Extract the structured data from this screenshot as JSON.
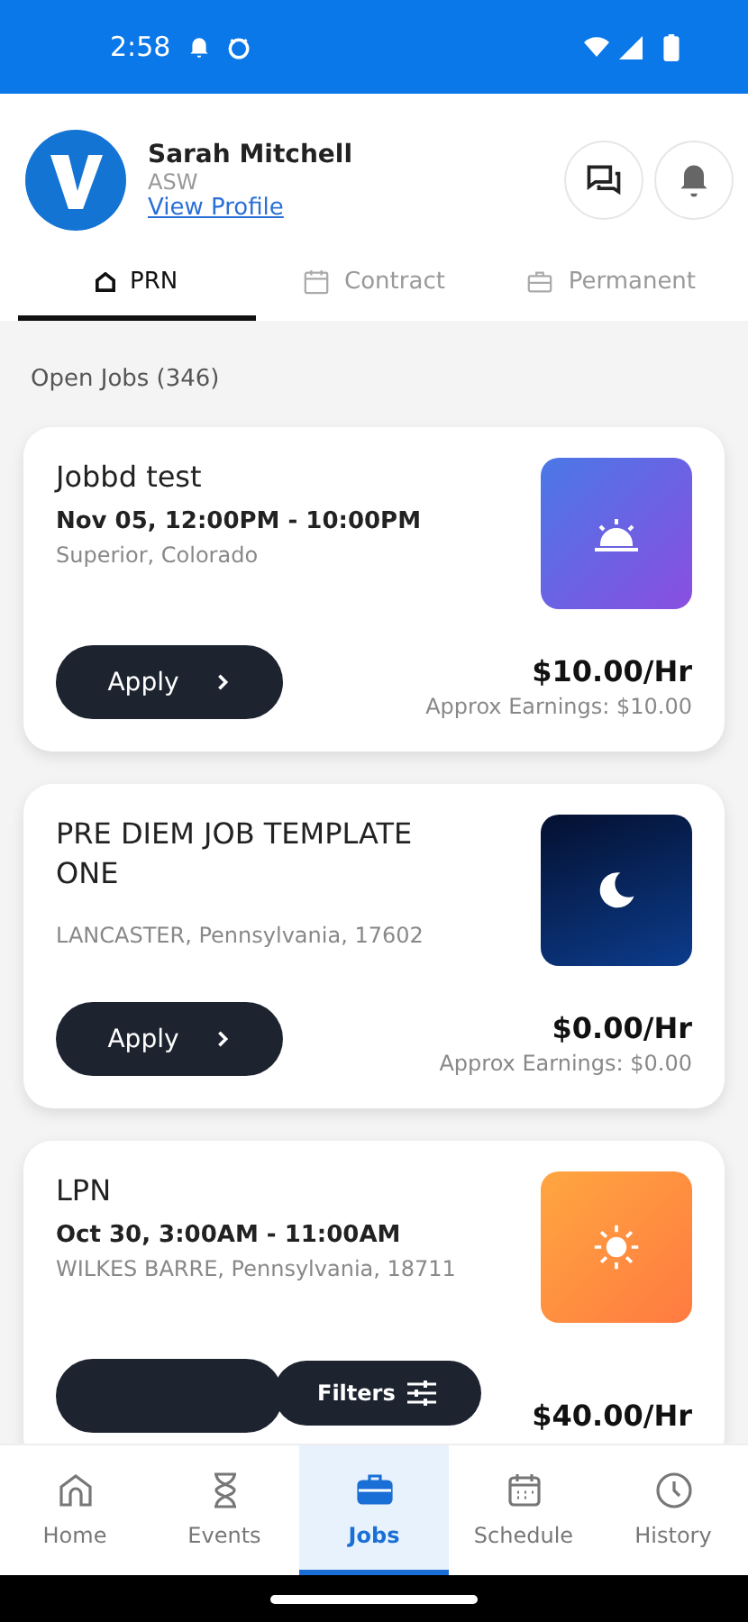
{
  "status_bar": {
    "time": "2:58"
  },
  "profile": {
    "name": "Sarah Mitchell",
    "role": "ASW",
    "link": "View Profile"
  },
  "tabs": [
    {
      "label": "PRN",
      "kind": "home",
      "selected": true
    },
    {
      "label": "Contract",
      "kind": "calendar",
      "selected": false
    },
    {
      "label": "Permanent",
      "kind": "briefcase",
      "selected": false
    }
  ],
  "section_title": "Open Jobs (346)",
  "jobs": [
    {
      "title": "Jobbd test",
      "time": "Nov 05, 12:00PM - 10:00PM",
      "location": "Superior, Colorado",
      "kind": "sunrise",
      "apply_label": "Apply",
      "rate": "$10.00/Hr",
      "earnings": "Approx Earnings: $10.00"
    },
    {
      "title": "PRE DIEM JOB TEMPLATE ONE",
      "location": "LANCASTER, Pennsylvania, 17602",
      "kind": "night",
      "apply_label": "Apply",
      "rate": "$0.00/Hr",
      "earnings": "Approx Earnings: $0.00"
    },
    {
      "title": "LPN",
      "time": "Oct 30, 3:00AM - 11:00AM",
      "location": "WILKES BARRE, Pennsylvania, 18711",
      "kind": "day",
      "rate": "$40.00/Hr"
    }
  ],
  "filters_button": "Filters",
  "nav": [
    {
      "label": "Home",
      "kind": "home",
      "selected": false
    },
    {
      "label": "Events",
      "kind": "hourglass",
      "selected": false
    },
    {
      "label": "Jobs",
      "kind": "briefcase",
      "selected": true
    },
    {
      "label": "Schedule",
      "kind": "calendar",
      "selected": false
    },
    {
      "label": "History",
      "kind": "clock",
      "selected": false
    }
  ]
}
